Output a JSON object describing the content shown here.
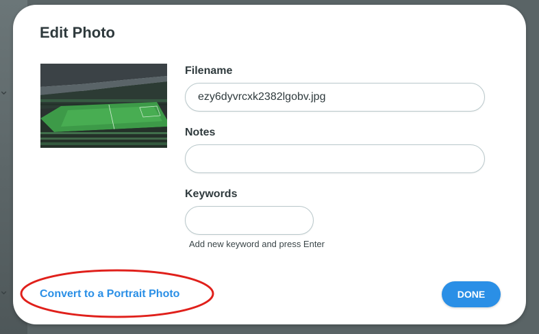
{
  "dialog": {
    "title": "Edit Photo"
  },
  "photo": {
    "description_icon": "stadium-photo-thumbnail"
  },
  "form": {
    "filename_label": "Filename",
    "filename_value": "ezy6dyvrcxk2382lgobv.jpg",
    "notes_label": "Notes",
    "notes_value": "",
    "keywords_label": "Keywords",
    "keywords_value": "",
    "keywords_hint": "Add new keyword and press Enter"
  },
  "actions": {
    "convert_label": "Convert to a Portrait Photo",
    "done_label": "DONE"
  },
  "colors": {
    "accent": "#2a8fe6",
    "highlight": "#e0201b",
    "text": "#2f3a3d"
  },
  "backdrop": {
    "chevron_icon": "chevron-down-icon"
  }
}
